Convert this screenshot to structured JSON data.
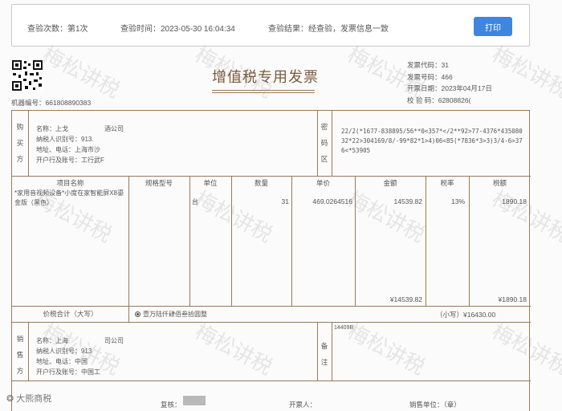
{
  "verify": {
    "count": "查验次数：第1次",
    "time": "查验时间：2023-05-30 16:04:34",
    "result": "查验结果：经查验，发票信息一致",
    "print_label": "打印"
  },
  "invoice": {
    "title": "增值税专用发票",
    "machine_no": "机器编号：661808890383",
    "code": "发票代码：31",
    "number": "发票号码：466",
    "date": "开票日期：2023年04月17日",
    "check_code": "校 验 码：62808826(",
    "buyer": {
      "side_label": "购买方",
      "name": "名称：上戈",
      "name_tail": "酒公司",
      "tax_id": "纳税人识别号：913.",
      "address": "地址、电话：上海市沙",
      "bank": "开户行及账号：工行武F"
    },
    "cipher_label": "密码区",
    "cipher": "22/2(*1677-838895/56**0<357*</2**92>77-4376*43508032*22>304169/8/-99*82*1>4)06<85(*7836*3>3)3/4-6>376<*53905",
    "headers": {
      "item": "项目名称",
      "spec": "规格型号",
      "unit": "单位",
      "qty": "数量",
      "price": "单价",
      "amount": "金额",
      "rate": "税率",
      "tax": "税额"
    },
    "line": {
      "item": "*家用音视频设备*小度在家智能屏X8鎏金版（黑色）",
      "unit": "台",
      "qty": "31",
      "price": "469.0264516",
      "amount": "14539.82",
      "rate": "13%",
      "tax": "1890.18"
    },
    "totals": {
      "amount": "¥14539.82",
      "tax": "¥1890.18"
    },
    "total_caps_label": "价税合计（大写）",
    "total_caps_value": "壹万陆仟肆佰叁拾圆整",
    "total_small": "（小写）¥16430.00",
    "seller": {
      "side_label": "销售方",
      "name": "名称：上海",
      "name_tail": "司公司",
      "tax_id": "纳税人识别号：913",
      "address": "地址、电话：中国",
      "bank": "开户行及账号：中国工"
    },
    "remark_label": "备注",
    "remark_value": "14409B"
  },
  "footer": {
    "brand": "大熊商税",
    "reviewer": "复核：",
    "issuer": "开票人：",
    "seller_seal": "销售单位：（章）"
  },
  "watermark_text": "梅松讲税"
}
